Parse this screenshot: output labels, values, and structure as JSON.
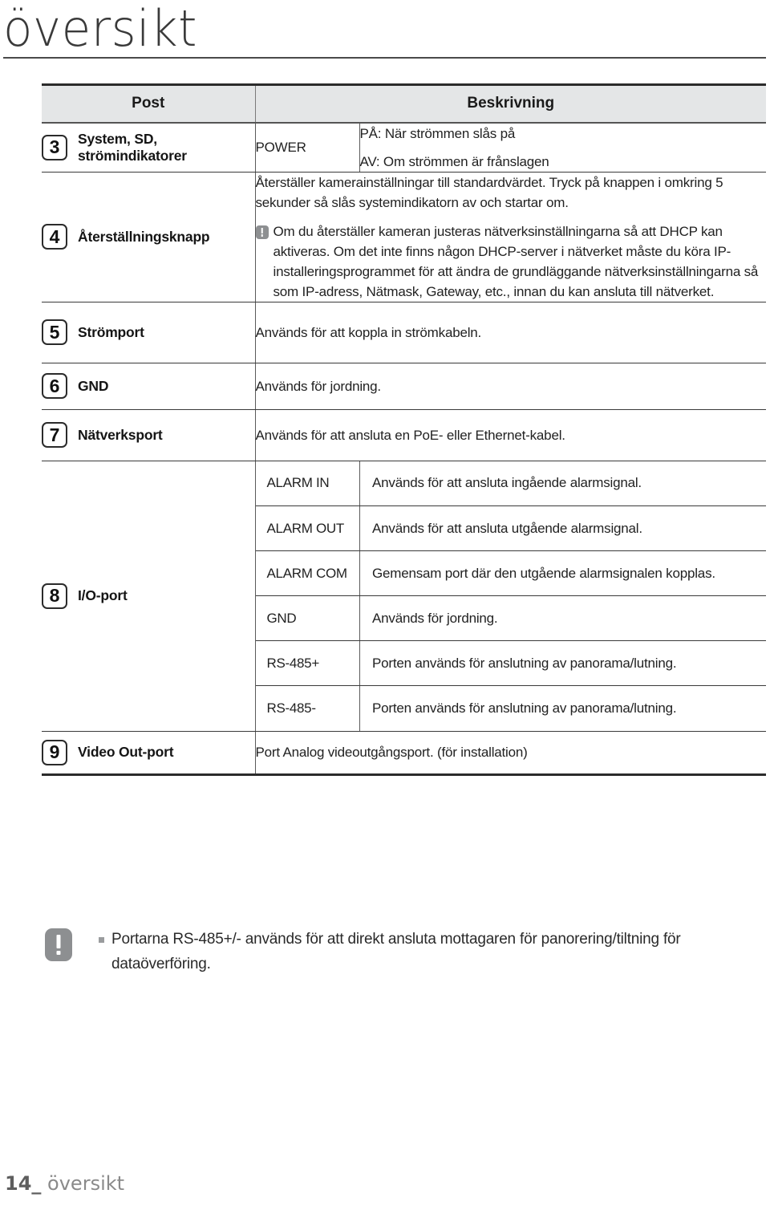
{
  "page": {
    "title": "översikt",
    "footer_number": "14_",
    "footer_section": "översikt"
  },
  "table": {
    "headers": {
      "item": "Post",
      "description": "Beskrivning"
    },
    "rows": [
      {
        "number": "3",
        "label": "System, SD,\nströmindikatorer",
        "label_line1": "System, SD,",
        "label_line2": "strömindikatorer",
        "sub_label": "POWER",
        "desc_line1": "PÅ: När strömmen slås på",
        "desc_line2": "AV: Om strömmen är frånslagen"
      },
      {
        "number": "4",
        "label": "Återställningsknapp",
        "desc_main": "Återställer kamerainställningar till standardvärdet. Tryck på knappen i omkring 5 sekunder så slås systemindikatorn av och startar om.",
        "note_icon": "warning-icon",
        "note_text": "Om du återställer kameran justeras nätverksinställningarna så att DHCP kan aktiveras. Om det inte finns någon DHCP-server i nätverket måste du köra IP-installeringsprogrammet för att ändra de grundläggande nätverksinställningarna så som IP-adress, Nätmask, Gateway, etc., innan du kan ansluta till nätverket."
      },
      {
        "number": "5",
        "label": "Strömport",
        "desc": "Används för att koppla in strömkabeln."
      },
      {
        "number": "6",
        "label": "GND",
        "desc": "Används för jordning."
      },
      {
        "number": "7",
        "label": "Nätverksport",
        "desc": "Används för att ansluta en PoE- eller Ethernet-kabel."
      },
      {
        "number": "8",
        "label": "I/O-port",
        "sub_rows": [
          {
            "name": "ALARM IN",
            "desc": "Används för att ansluta ingående alarmsignal."
          },
          {
            "name": "ALARM OUT",
            "desc": "Används för att ansluta utgående alarmsignal."
          },
          {
            "name": "ALARM COM",
            "desc": "Gemensam port där den utgående alarmsignalen kopplas."
          },
          {
            "name": "GND",
            "desc": "Används för jordning."
          },
          {
            "name": "RS-485+",
            "desc": "Porten används för anslutning av panorama/lutning."
          },
          {
            "name": "RS-485-",
            "desc": "Porten används för anslutning av panorama/lutning."
          }
        ]
      },
      {
        "number": "9",
        "label": "Video Out-port",
        "desc": "Port Analog videoutgångsport. (för installation)"
      }
    ]
  },
  "footnote": {
    "icon": "warning-icon",
    "bullet": "square-bullet",
    "text": "Portarna RS-485+/- används för att direkt ansluta mottagaren för panorering/tiltning för dataöverföring."
  },
  "colors": {
    "header_band": "#e4e6e7",
    "rule": "#2b2b2b",
    "note_icon": "#8d8f91",
    "footer_text": "#7d7d7d"
  }
}
